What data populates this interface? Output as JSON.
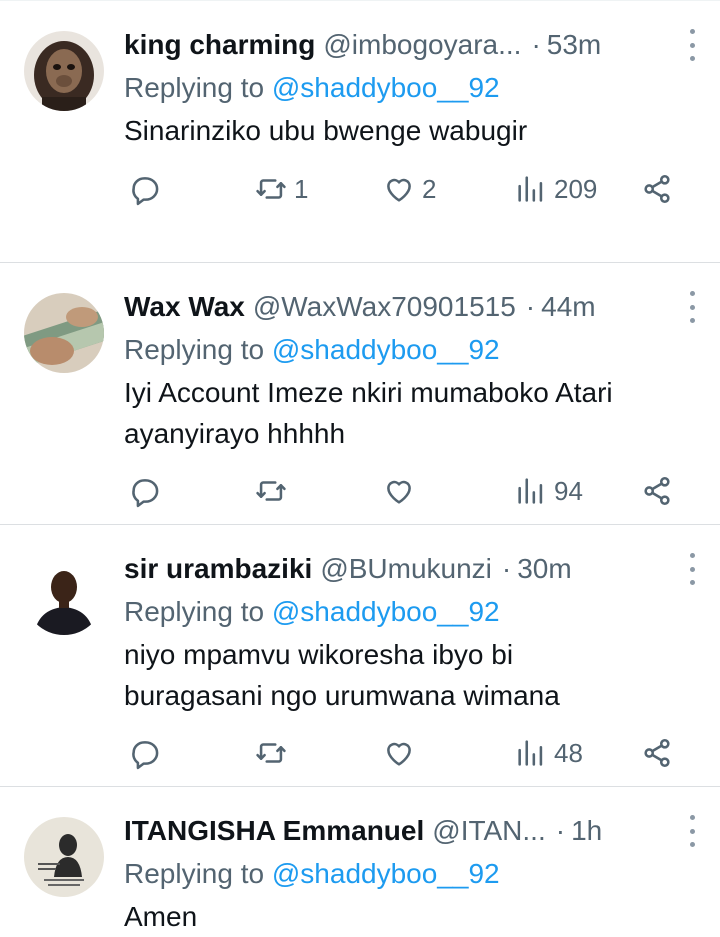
{
  "replies": [
    {
      "name": "king charming",
      "handle": "@imbogoyara...",
      "separator": "·",
      "time": "53m",
      "replying_prefix": "Replying to",
      "replying_to": "@shaddyboo__92",
      "text": "Sinarinziko ubu bwenge wabugir",
      "retweets": "1",
      "likes": "2",
      "views": "209",
      "avatar_colors": [
        "#3a2a22",
        "#8a6a52"
      ]
    },
    {
      "name": "Wax Wax",
      "handle": "@WaxWax70901515",
      "separator": "·",
      "time": "44m",
      "replying_prefix": "Replying to",
      "replying_to": "@shaddyboo__92",
      "text_line1": "Iyi Account Imeze nkiri mumaboko Atari",
      "text_line2": "ayanyirayo hhhhh",
      "retweets": "",
      "likes": "",
      "views": "94",
      "avatar_colors": [
        "#c9b59a",
        "#5f7a63"
      ]
    },
    {
      "name": "sir urambaziki",
      "handle": "@BUmukunzi",
      "separator": "·",
      "time": "30m",
      "replying_prefix": "Replying to",
      "replying_to": "@shaddyboo__92",
      "text_line1": "niyo mpamvu wikoresha ibyo bi",
      "text_line2": "buragasani ngo urumwana wimana",
      "retweets": "",
      "likes": "",
      "views": "48",
      "avatar_colors": [
        "#ffffff",
        "#3b2418"
      ]
    },
    {
      "name": "ITANGISHA Emmanuel",
      "handle": "@ITAN...",
      "separator": "·",
      "time": "1h",
      "replying_prefix": "Replying to",
      "replying_to": "@shaddyboo__92",
      "text": "Amen",
      "avatar_colors": [
        "#e8e4da",
        "#2b2b2b"
      ]
    }
  ],
  "colors": {
    "text": "#0f1419",
    "muted": "#536471",
    "link": "#1d9bf0",
    "border": "#dcdfe2"
  },
  "icons": [
    "reply-icon",
    "retweet-icon",
    "like-icon",
    "views-icon",
    "share-icon",
    "more-icon"
  ]
}
